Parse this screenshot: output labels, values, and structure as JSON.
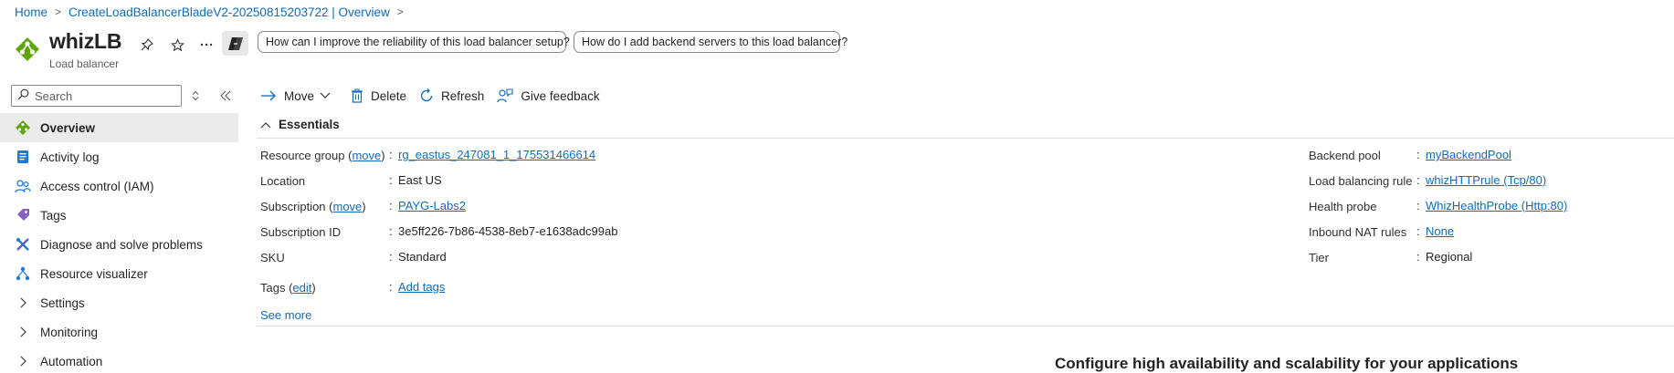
{
  "breadcrumb": {
    "items": [
      "Home",
      "CreateLoadBalancerBladeV2-20250815203722 | Overview"
    ]
  },
  "header": {
    "title": "whizLB",
    "subtitle": "Load balancer",
    "prompts": [
      "How can I improve the reliability of this load balancer setup?",
      "How do I add backend servers to this load balancer?"
    ]
  },
  "sidebar": {
    "search_placeholder": "Search",
    "items": [
      {
        "label": "Overview",
        "icon": "overview-icon",
        "active": true
      },
      {
        "label": "Activity log",
        "icon": "activity-log-icon"
      },
      {
        "label": "Access control (IAM)",
        "icon": "people-icon"
      },
      {
        "label": "Tags",
        "icon": "tag-icon"
      },
      {
        "label": "Diagnose and solve problems",
        "icon": "wrench-icon"
      },
      {
        "label": "Resource visualizer",
        "icon": "hierarchy-icon"
      },
      {
        "label": "Settings",
        "icon": "chevron-right-icon"
      },
      {
        "label": "Monitoring",
        "icon": "chevron-right-icon"
      },
      {
        "label": "Automation",
        "icon": "chevron-right-icon"
      }
    ]
  },
  "commands": {
    "move": "Move",
    "delete": "Delete",
    "refresh": "Refresh",
    "feedback": "Give feedback"
  },
  "essentials": {
    "heading": "Essentials",
    "left": {
      "resource_group_label": "Resource group",
      "resource_group_move": "move",
      "resource_group_value": "rg_eastus_247081_1_175531466614",
      "location_label": "Location",
      "location_value": "East US",
      "subscription_label": "Subscription",
      "subscription_move": "move",
      "subscription_value": "PAYG-Labs2",
      "subscription_id_label": "Subscription ID",
      "subscription_id_value": "3e5ff226-7b86-4538-8eb7-e1638adc99ab",
      "sku_label": "SKU",
      "sku_value": "Standard",
      "tags_label": "Tags",
      "tags_edit": "edit",
      "tags_value": "Add tags"
    },
    "right": {
      "backend_pool_label": "Backend pool",
      "backend_pool_value": "myBackendPool",
      "lb_rule_label": "Load balancing rule",
      "lb_rule_value": "whizHTTPrule (Tcp/80)",
      "health_probe_label": "Health probe",
      "health_probe_value": "WhizHealthProbe (Http:80)",
      "nat_label": "Inbound NAT rules",
      "nat_value": "None",
      "tier_label": "Tier",
      "tier_value": "Regional"
    },
    "separator": ":",
    "see_more": "See more"
  },
  "promo": {
    "heading": "Configure high availability and scalability for your applications"
  },
  "colors": {
    "link": "#0f6cbd",
    "active_nav_bg": "#ebebeb",
    "lb_icon_green": "#5ea70a"
  }
}
